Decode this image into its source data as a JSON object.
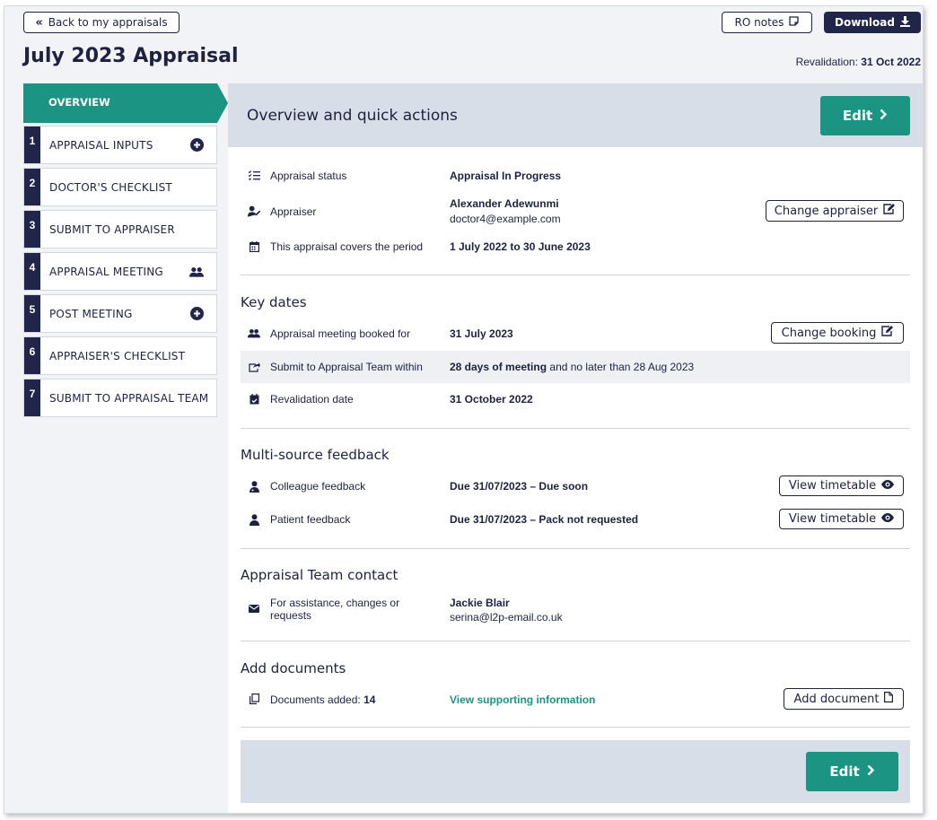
{
  "header": {
    "back_label": "Back to my appraisals",
    "ro_notes_label": "RO notes",
    "download_label": "Download",
    "page_title": "July 2023 Appraisal",
    "revalidation_prefix": "Revalidation:",
    "revalidation_date": "31 Oct 2022"
  },
  "sidebar": {
    "active": "OVERVIEW",
    "items": [
      {
        "num": "1",
        "label": "APPRAISAL INPUTS",
        "icon": "plus-circle-icon"
      },
      {
        "num": "2",
        "label": "DOCTOR'S CHECKLIST",
        "icon": ""
      },
      {
        "num": "3",
        "label": "SUBMIT TO APPRAISER",
        "icon": ""
      },
      {
        "num": "4",
        "label": "APPRAISAL MEETING",
        "icon": "people-icon"
      },
      {
        "num": "5",
        "label": "POST MEETING",
        "icon": "plus-circle-icon"
      },
      {
        "num": "6",
        "label": "APPRAISER'S CHECKLIST",
        "icon": ""
      },
      {
        "num": "7",
        "label": "SUBMIT TO APPRAISAL TEAM",
        "icon": ""
      }
    ]
  },
  "main": {
    "title": "Overview and quick actions",
    "edit_label": "Edit",
    "status_label": "Appraisal status",
    "status_value": "Appraisal In Progress",
    "appraiser_label": "Appraiser",
    "appraiser_name": "Alexander Adewunmi",
    "appraiser_email": "doctor4@example.com",
    "change_appraiser": "Change appraiser",
    "period_label": "This appraisal covers the period",
    "period_value": "1 July 2022 to 30 June 2023",
    "key_dates_title": "Key dates",
    "meeting_label": "Appraisal meeting booked for",
    "meeting_value": "31 July 2023",
    "change_booking": "Change booking",
    "submit_label": "Submit to Appraisal Team within",
    "submit_bold": "28 days of meeting",
    "submit_rest": "and no later than 28 Aug 2023",
    "reval_label": "Revalidation date",
    "reval_value": "31 October 2022",
    "msf_title": "Multi-source feedback",
    "colleague_label": "Colleague feedback",
    "colleague_value": "Due 31/07/2023 – Due soon",
    "patient_label": "Patient feedback",
    "patient_value": "Due 31/07/2023 – Pack not requested",
    "view_timetable": "View timetable",
    "contact_title": "Appraisal Team contact",
    "contact_label_1": "For assistance, changes or",
    "contact_label_2": "requests",
    "contact_name": "Jackie Blair",
    "contact_email": "serina@l2p-email.co.uk",
    "docs_title": "Add documents",
    "docs_label": "Documents added:",
    "docs_count": "14",
    "view_supporting": "View supporting information",
    "add_document": "Add document",
    "footer_edit_label": "Edit"
  },
  "colors": {
    "navy": "#22254a",
    "teal": "#1c9483",
    "panel_header": "#d8dee8"
  }
}
